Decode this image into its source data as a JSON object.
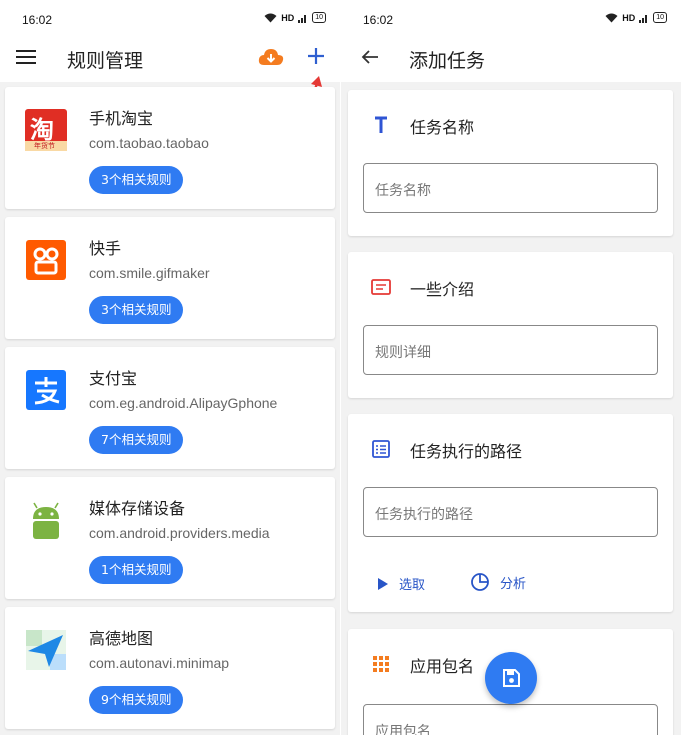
{
  "status_bar": {
    "time": "16:02",
    "network": "HD",
    "battery": "10"
  },
  "left_screen": {
    "title": "规则管理",
    "apps": [
      {
        "name": "手机淘宝",
        "package": "com.taobao.taobao",
        "rules": "3个相关规则",
        "icon": "taobao-icon"
      },
      {
        "name": "快手",
        "package": "com.smile.gifmaker",
        "rules": "3个相关规则",
        "icon": "kuaishou-icon"
      },
      {
        "name": "支付宝",
        "package": "com.eg.android.AlipayGphone",
        "rules": "7个相关规则",
        "icon": "alipay-icon"
      },
      {
        "name": "媒体存储设备",
        "package": "com.android.providers.media",
        "rules": "1个相关规则",
        "icon": "android-icon"
      },
      {
        "name": "高德地图",
        "package": "com.autonavi.minimap",
        "rules": "9个相关规则",
        "icon": "amap-icon"
      }
    ],
    "taobao_badge": "淘",
    "taobao_sub": "年货节"
  },
  "right_screen": {
    "title": "添加任务",
    "sections": {
      "name": {
        "title": "任务名称",
        "placeholder": "任务名称"
      },
      "intro": {
        "title": "一些介绍",
        "placeholder": "规则详细"
      },
      "path": {
        "title": "任务执行的路径",
        "placeholder": "任务执行的路径",
        "select_label": "选取",
        "analyze_label": "分析"
      },
      "package": {
        "title": "应用包名",
        "placeholder": "应用包名"
      }
    }
  },
  "colors": {
    "accent": "#2f7bf2",
    "link": "#2855c7",
    "annotation": "#e53935",
    "cloud": "#f47c20"
  }
}
